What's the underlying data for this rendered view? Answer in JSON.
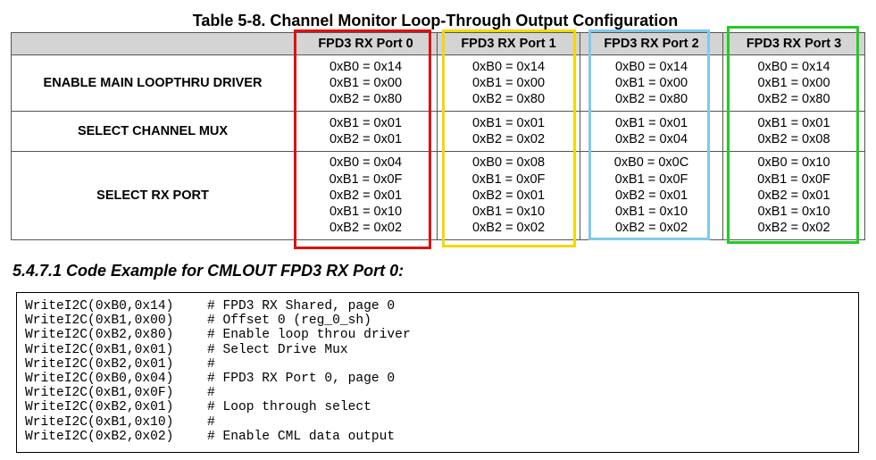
{
  "table": {
    "title": "Table 5-8. Channel Monitor Loop-Through Output Configuration",
    "columns": [
      "",
      "FPD3 RX Port 0",
      "FPD3 RX Port 1",
      "FPD3 RX Port 2",
      "FPD3 RX Port 3"
    ],
    "rows": [
      {
        "label": "ENABLE MAIN LOOPTHRU DRIVER",
        "cells": [
          [
            "0xB0 = 0x14",
            "0xB1 = 0x00",
            "0xB2 = 0x80"
          ],
          [
            "0xB0 = 0x14",
            "0xB1 = 0x00",
            "0xB2 = 0x80"
          ],
          [
            "0xB0 = 0x14",
            "0xB1 = 0x00",
            "0xB2 = 0x80"
          ],
          [
            "0xB0 = 0x14",
            "0xB1 = 0x00",
            "0xB2 = 0x80"
          ]
        ]
      },
      {
        "label": "SELECT CHANNEL MUX",
        "cells": [
          [
            "0xB1 = 0x01",
            "0xB2 = 0x01"
          ],
          [
            "0xB1 = 0x01",
            "0xB2 = 0x02"
          ],
          [
            "0xB1 = 0x01",
            "0xB2 = 0x04"
          ],
          [
            "0xB1 = 0x01",
            "0xB2 = 0x08"
          ]
        ]
      },
      {
        "label": "SELECT RX PORT",
        "cells": [
          [
            "0xB0 = 0x04",
            "0xB1 = 0x0F",
            "0xB2 = 0x01",
            "0xB1 = 0x10",
            "0xB2 = 0x02"
          ],
          [
            "0xB0 = 0x08",
            "0xB1 = 0x0F",
            "0xB2 = 0x01",
            "0xB1 = 0x10",
            "0xB2 = 0x02"
          ],
          [
            "0xB0 = 0x0C",
            "0xB1 = 0x0F",
            "0xB2 = 0x01",
            "0xB1 = 0x10",
            "0xB2 = 0x02"
          ],
          [
            "0xB0 = 0x10",
            "0xB1 = 0x0F",
            "0xB2 = 0x01",
            "0xB1 = 0x10",
            "0xB2 = 0x02"
          ]
        ]
      }
    ],
    "highlight_colors": {
      "port0": "#e01010",
      "port1": "#f5d800",
      "port2": "#80c8f0",
      "port3": "#22cc22"
    }
  },
  "section": {
    "heading": "5.4.7.1 Code Example for CMLOUT FPD3 RX Port 0:"
  },
  "code": {
    "lines": [
      {
        "cmd": "WriteI2C(0xB0,0x14)",
        "comment": "# FPD3 RX Shared, page 0"
      },
      {
        "cmd": "WriteI2C(0xB1,0x00)",
        "comment": "# Offset 0 (reg_0_sh)"
      },
      {
        "cmd": "WriteI2C(0xB2,0x80)",
        "comment": "# Enable loop throu driver"
      },
      {
        "cmd": "WriteI2C(0xB1,0x01)",
        "comment": "# Select Drive Mux"
      },
      {
        "cmd": "WriteI2C(0xB2,0x01)",
        "comment": "#"
      },
      {
        "cmd": "WriteI2C(0xB0,0x04)",
        "comment": "# FPD3 RX Port 0, page 0"
      },
      {
        "cmd": "WriteI2C(0xB1,0x0F)",
        "comment": "#"
      },
      {
        "cmd": "WriteI2C(0xB2,0x01)",
        "comment": "# Loop through select"
      },
      {
        "cmd": "WriteI2C(0xB1,0x10)",
        "comment": "#"
      },
      {
        "cmd": "WriteI2C(0xB2,0x02)",
        "comment": "# Enable CML data output"
      }
    ]
  }
}
